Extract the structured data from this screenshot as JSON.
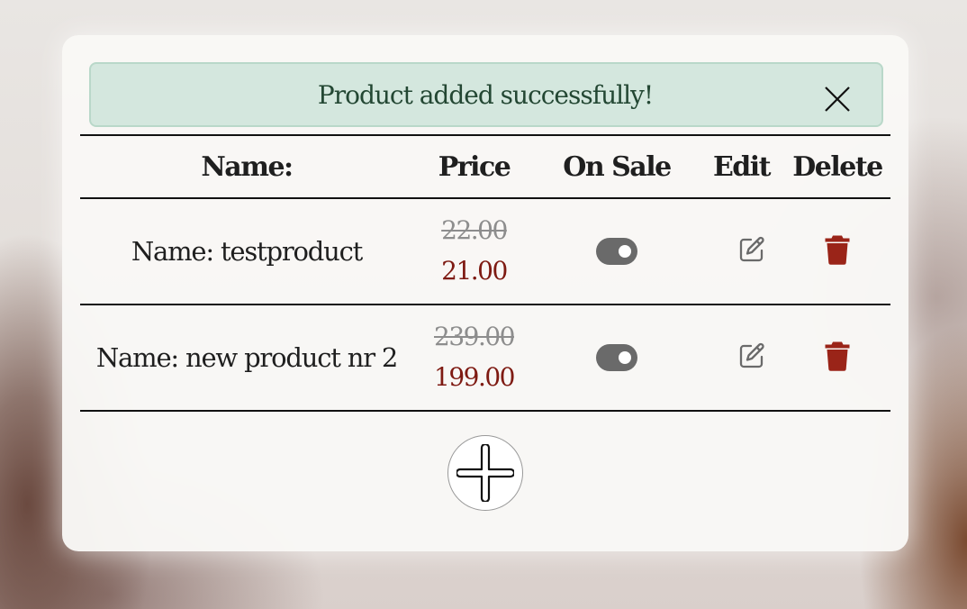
{
  "alert": {
    "message": "Product added successfully!"
  },
  "table": {
    "headers": {
      "name": "Name:",
      "price": "Price",
      "on_sale": "On Sale",
      "edit": "Edit",
      "delete": "Delete"
    },
    "rows": [
      {
        "name": "Name: testproduct",
        "original_price": "22.00",
        "sale_price": "21.00",
        "on_sale": true
      },
      {
        "name": "Name: new product nr 2",
        "original_price": "239.00",
        "sale_price": "199.00",
        "on_sale": true
      }
    ]
  },
  "icons": {
    "close": "close-icon",
    "edit": "edit-icon",
    "delete": "trash-icon",
    "add": "plus-icon"
  },
  "colors": {
    "alert_bg": "#d4e7de",
    "alert_text": "#234733",
    "sale_price": "#7e1a12",
    "delete_icon": "#9a2418",
    "toggle": "#6a6a6a"
  }
}
